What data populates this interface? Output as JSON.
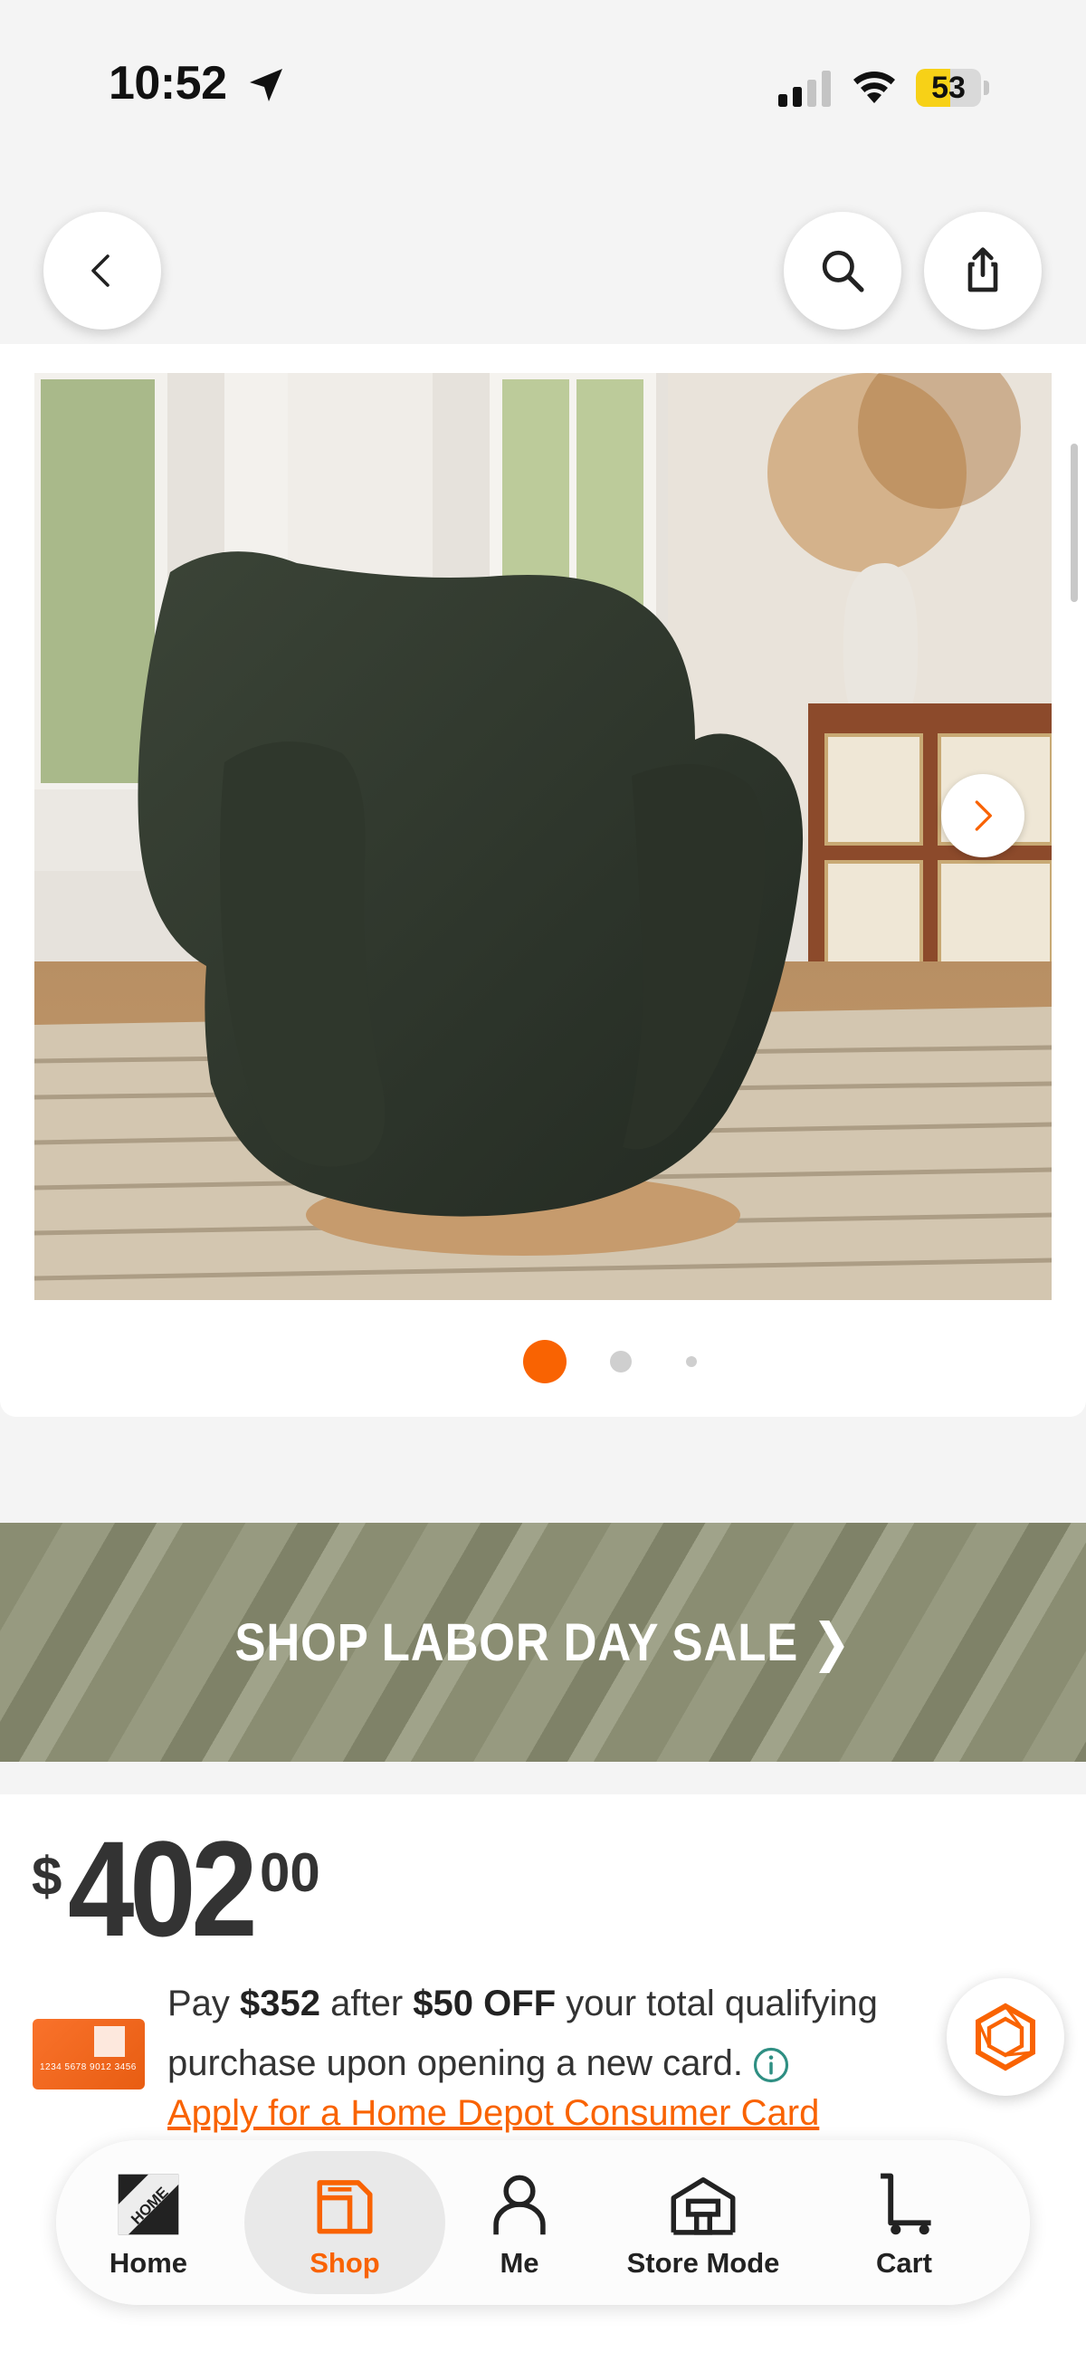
{
  "status_bar": {
    "time": "10:52",
    "battery": "53",
    "battery_level": 0.53
  },
  "header": {
    "back_icon": "chevron-left-icon",
    "search_icon": "search-icon",
    "share_icon": "share-icon"
  },
  "gallery": {
    "image_description": "Dark green boucle swivel accent chair",
    "image_count": 3,
    "active_index": 0,
    "next_icon": "chevron-right-icon"
  },
  "banner": {
    "label": "SHOP LABOR DAY SALE ❯"
  },
  "price": {
    "dollar": "$",
    "whole": "402",
    "cents": "00"
  },
  "promo": {
    "pay_prefix": "Pay ",
    "pay_amount": "$352",
    "after": " after ",
    "discount": "$50 OFF",
    "suffix": " your total qualifying purchase upon opening a new card.",
    "apply_link": "Apply for a Home Depot Consumer Card"
  },
  "bottom_nav": {
    "items": [
      {
        "label": "Home",
        "icon": "home-depot-logo-icon"
      },
      {
        "label": "Shop",
        "icon": "shop-bag-icon",
        "active": true
      },
      {
        "label": "Me",
        "icon": "person-icon"
      },
      {
        "label": "Store Mode",
        "icon": "store-icon"
      },
      {
        "label": "Cart",
        "icon": "cart-icon"
      }
    ]
  },
  "colors": {
    "brand_orange": "#f96302",
    "banner_green": "#8a8d72"
  }
}
